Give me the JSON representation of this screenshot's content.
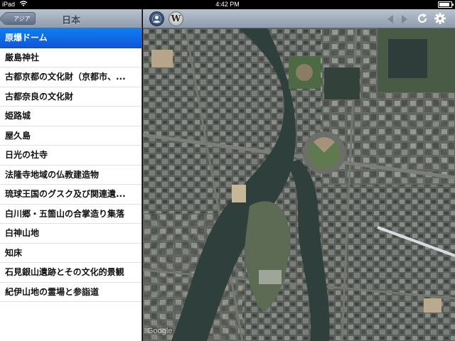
{
  "status": {
    "carrier": "iPad",
    "time": "4:42 PM",
    "battery_level": 0.9
  },
  "sidebar": {
    "back_label": "アジア",
    "title": "日本",
    "items": [
      {
        "label": "原爆ドーム",
        "selected": true
      },
      {
        "label": "厳島神社"
      },
      {
        "label": "古都京都の文化財（京都市、..."
      },
      {
        "label": "古都奈良の文化財"
      },
      {
        "label": "姫路城"
      },
      {
        "label": "屋久島"
      },
      {
        "label": "日光の社寺"
      },
      {
        "label": "法隆寺地域の仏教建造物"
      },
      {
        "label": "琉球王国のグスク及び関連遺..."
      },
      {
        "label": "白川郷・五箇山の合掌造り集落"
      },
      {
        "label": "白神山地"
      },
      {
        "label": "知床"
      },
      {
        "label": "石見銀山遺跡とその文化的景観"
      },
      {
        "label": "紀伊山地の霊場と参詣道"
      }
    ]
  },
  "toolbar": {
    "user_icon": "person-icon",
    "wiki_label": "W",
    "back_icon": "arrow-left-icon",
    "forward_icon": "arrow-right-icon",
    "refresh_icon": "refresh-icon",
    "settings_icon": "gear-icon"
  },
  "map": {
    "type": "satellite",
    "attribution": "Google"
  },
  "colors": {
    "selected_row": "#1166e6",
    "toolbar": "#a3aebd",
    "river": "#2f3f3c"
  }
}
